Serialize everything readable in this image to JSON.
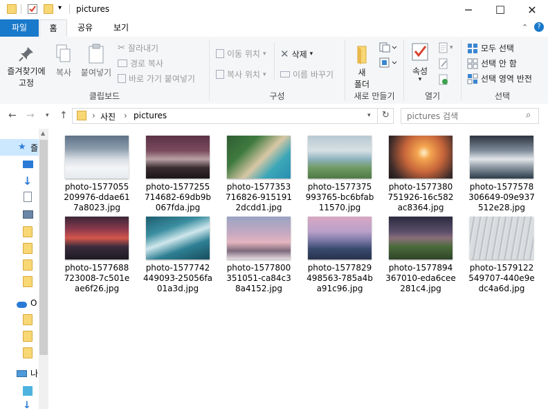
{
  "window": {
    "title": "pictures",
    "controls": {
      "minimize": "─",
      "maximize": "☐",
      "close": "✕"
    }
  },
  "ribbon_tabs": [
    {
      "label": "파일"
    },
    {
      "label": "홈"
    },
    {
      "label": "공유"
    },
    {
      "label": "보기"
    }
  ],
  "ribbon": {
    "clipboard": {
      "pin_label_line1": "즐겨찾기에",
      "pin_label_line2": "고정",
      "copy": "복사",
      "paste": "붙여넣기",
      "cut": "잘라내기",
      "copy_path": "경로 복사",
      "paste_shortcut": "바로 가기 붙여넣기",
      "group": "클립보드"
    },
    "organize": {
      "move_to": "이동 위치",
      "copy_to": "복사 위치",
      "delete": "삭제",
      "rename": "이름 바꾸기",
      "group": "구성"
    },
    "new": {
      "new_folder_line1": "새",
      "new_folder_line2": "폴더",
      "group": "새로 만들기"
    },
    "open": {
      "properties": "속성",
      "group": "열기"
    },
    "select": {
      "select_all": "모두 선택",
      "select_none": "선택 안 함",
      "invert": "선택 영역 반전",
      "group": "선택"
    }
  },
  "address": {
    "crumbs": [
      "사진",
      "pictures"
    ],
    "separator": "›"
  },
  "search": {
    "placeholder": "pictures 검색"
  },
  "nav": {
    "quick_access": "즐",
    "onedrive": "O",
    "this_pc": "나"
  },
  "files": [
    {
      "name": "photo-1577055\n209976-ddae61\n7a8023.jpg"
    },
    {
      "name": "photo-1577255\n714682-69db9b\n067fda.jpg"
    },
    {
      "name": "photo-1577353\n716826-915191\n2dcdd1.jpg"
    },
    {
      "name": "photo-1577375\n993765-bc6bfab\n11570.jpg"
    },
    {
      "name": "photo-1577380\n751926-16c582\nac8364.jpg"
    },
    {
      "name": "photo-1577578\n306649-09e937\n512e28.jpg"
    },
    {
      "name": "photo-1577688\n723008-7c501e\nae6f26.jpg"
    },
    {
      "name": "photo-1577742\n449093-25056fa\n01a3d.jpg"
    },
    {
      "name": "photo-1577800\n351051-ca84c3\n8a4152.jpg"
    },
    {
      "name": "photo-1577829\n498563-785a4b\na91c96.jpg"
    },
    {
      "name": "photo-1577894\n367010-eda6cee\n281c4.jpg"
    },
    {
      "name": "photo-1579122\n549707-440e9e\ndc4a6d.jpg"
    }
  ],
  "colors": {
    "accent": "#1979ca",
    "selected": "#cce8ff"
  }
}
